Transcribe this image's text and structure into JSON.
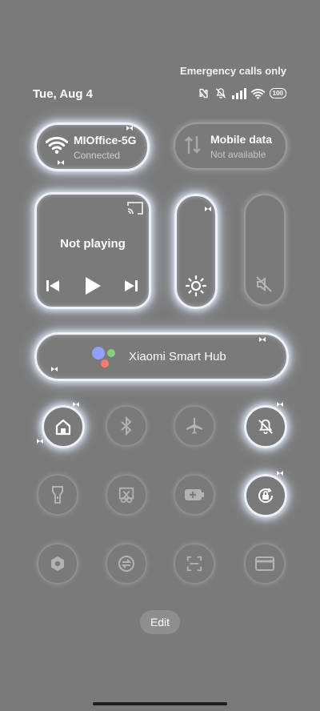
{
  "status": {
    "emergency": "Emergency calls only",
    "date": "Tue, Aug 4",
    "battery": "100",
    "icons": [
      "nfc-icon",
      "mute-icon",
      "signal-icon",
      "wifi-icon",
      "battery-icon"
    ]
  },
  "wifi": {
    "title": "MIOffice-5G",
    "subtitle": "Connected"
  },
  "mobile": {
    "title": "Mobile data",
    "subtitle": "Not available"
  },
  "media": {
    "title": "Not playing"
  },
  "hub": {
    "label": "Xiaomi Smart Hub"
  },
  "toggles": [
    {
      "name": "home",
      "active": true
    },
    {
      "name": "bluetooth",
      "active": false
    },
    {
      "name": "airplane-mode",
      "active": false
    },
    {
      "name": "do-not-disturb",
      "active": true
    },
    {
      "name": "flashlight",
      "active": false
    },
    {
      "name": "screenshot",
      "active": false
    },
    {
      "name": "battery-saver",
      "active": false
    },
    {
      "name": "rotation-lock",
      "active": true
    },
    {
      "name": "settings",
      "active": false
    },
    {
      "name": "sync",
      "active": false
    },
    {
      "name": "scanner",
      "active": false
    },
    {
      "name": "card",
      "active": false
    }
  ],
  "edit_label": "Edit",
  "colors": {
    "background": "#7a7a7a",
    "glow": "#eef2f8",
    "hub_blue": "#8fa0ff",
    "hub_green": "#7fd27a",
    "hub_red": "#ff7a6a"
  }
}
